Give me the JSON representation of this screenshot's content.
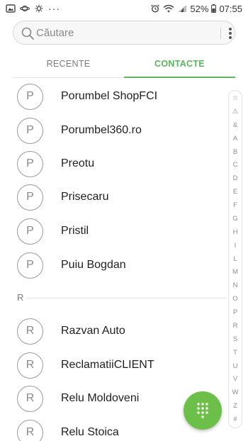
{
  "status_bar": {
    "battery": "52%",
    "time": "07:55",
    "overflow_dots": "···"
  },
  "search": {
    "placeholder": "Căutare"
  },
  "tabs": [
    {
      "label": "RECENTE",
      "active": false
    },
    {
      "label": "CONTACTE",
      "active": true
    }
  ],
  "contacts": [
    {
      "initial": "P",
      "name": "Porumbel ShopFCI"
    },
    {
      "initial": "P",
      "name": "Porumbel360.ro"
    },
    {
      "initial": "P",
      "name": "Preotu"
    },
    {
      "initial": "P",
      "name": "Prisecaru"
    },
    {
      "initial": "P",
      "name": "Pristil"
    },
    {
      "initial": "P",
      "name": "Puiu Bogdan"
    }
  ],
  "section_r": {
    "letter": "R",
    "contacts": [
      {
        "initial": "R",
        "name": "Razvan Auto"
      },
      {
        "initial": "R",
        "name": "ReclamatiiCLIENT"
      },
      {
        "initial": "R",
        "name": "Relu Moldoveni"
      },
      {
        "initial": "R",
        "name": "Relu Stoica"
      }
    ]
  },
  "index_letters": [
    "☆",
    "⚠",
    "&",
    "A",
    "B",
    "C",
    "D",
    "E",
    "F",
    "G",
    "H",
    "I",
    "L",
    "M",
    "N",
    "O",
    "P",
    "R",
    "S",
    "T",
    "U",
    "V",
    "W",
    "Z",
    "#"
  ],
  "colors": {
    "accent": "#5cb660",
    "fab": "#6cc04a"
  },
  "icons": {
    "fab": "dialpad-icon",
    "search": "search-icon",
    "menu": "more-vert-icon"
  }
}
